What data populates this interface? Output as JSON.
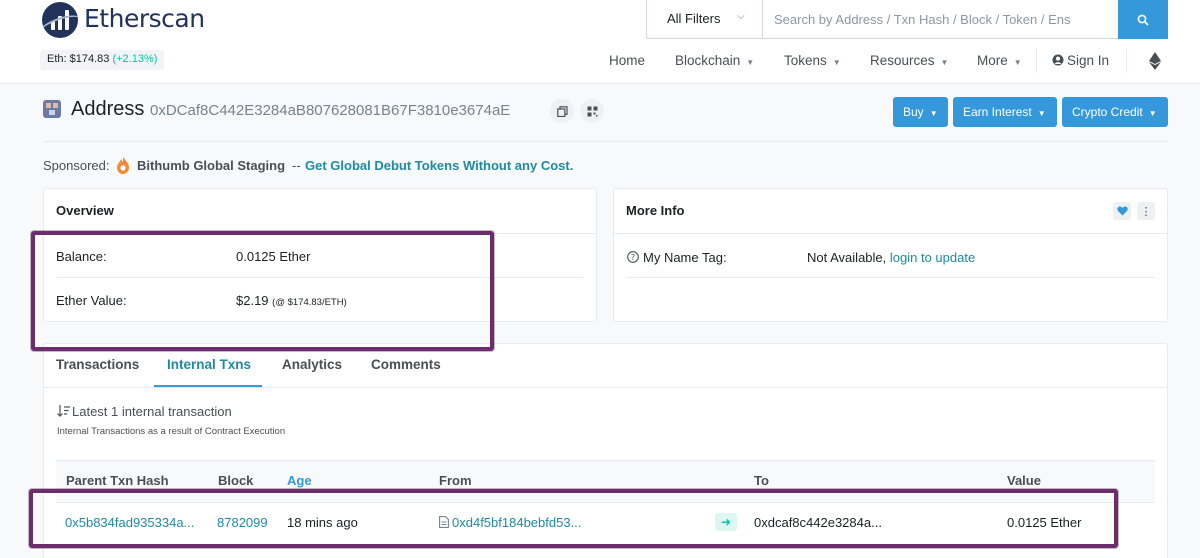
{
  "header": {
    "logo_text": "Etherscan",
    "eth_price_label": "Eth: $174.83",
    "eth_price_change": "(+2.13%)",
    "filter_label": "All Filters",
    "search_placeholder": "Search by Address / Txn Hash / Block / Token / Ens",
    "nav": {
      "home": "Home",
      "blockchain": "Blockchain",
      "tokens": "Tokens",
      "resources": "Resources",
      "more": "More",
      "sign_in": "Sign In"
    }
  },
  "address": {
    "title": "Address",
    "hash": "0xDCaf8C442E3284aB807628081B67F3810e3674aE",
    "buttons": {
      "buy": "Buy",
      "earn_interest": "Earn Interest",
      "crypto_credit": "Crypto Credit"
    }
  },
  "sponsored": {
    "label": "Sponsored:",
    "name": "Bithumb Global Staging",
    "dash": "--",
    "link_text": "Get Global Debut Tokens Without any Cost."
  },
  "overview": {
    "title": "Overview",
    "balance_label": "Balance:",
    "balance_value": "0.0125 Ether",
    "ether_value_label": "Ether Value:",
    "ether_value": "$2.19",
    "ether_rate": "(@ $174.83/ETH)"
  },
  "more_info": {
    "title": "More Info",
    "name_tag_label": "My Name Tag:",
    "name_tag_value": "Not Available,",
    "name_tag_link": "login to update"
  },
  "tabs": {
    "transactions": "Transactions",
    "internal_txns": "Internal Txns",
    "analytics": "Analytics",
    "comments": "Comments"
  },
  "internal": {
    "latest": "Latest 1 internal transaction",
    "subtitle": "Internal Transactions as a result of Contract Execution",
    "columns": {
      "parent_hash": "Parent Txn Hash",
      "block": "Block",
      "age": "Age",
      "from": "From",
      "to": "To",
      "value": "Value"
    },
    "row": {
      "parent_hash": "0x5b834fad935334a...",
      "block": "8782099",
      "age": "18 mins ago",
      "from": "0xd4f5bf184bebfd53...",
      "to": "0xdcaf8c442e3284a...",
      "value": "0.0125 Ether"
    }
  },
  "colors": {
    "brand": "#21325b",
    "accent_blue": "#3498db",
    "link_teal": "#1e8aa6",
    "positive": "#00c9a7",
    "highlight_box": "#6b2d6b"
  }
}
